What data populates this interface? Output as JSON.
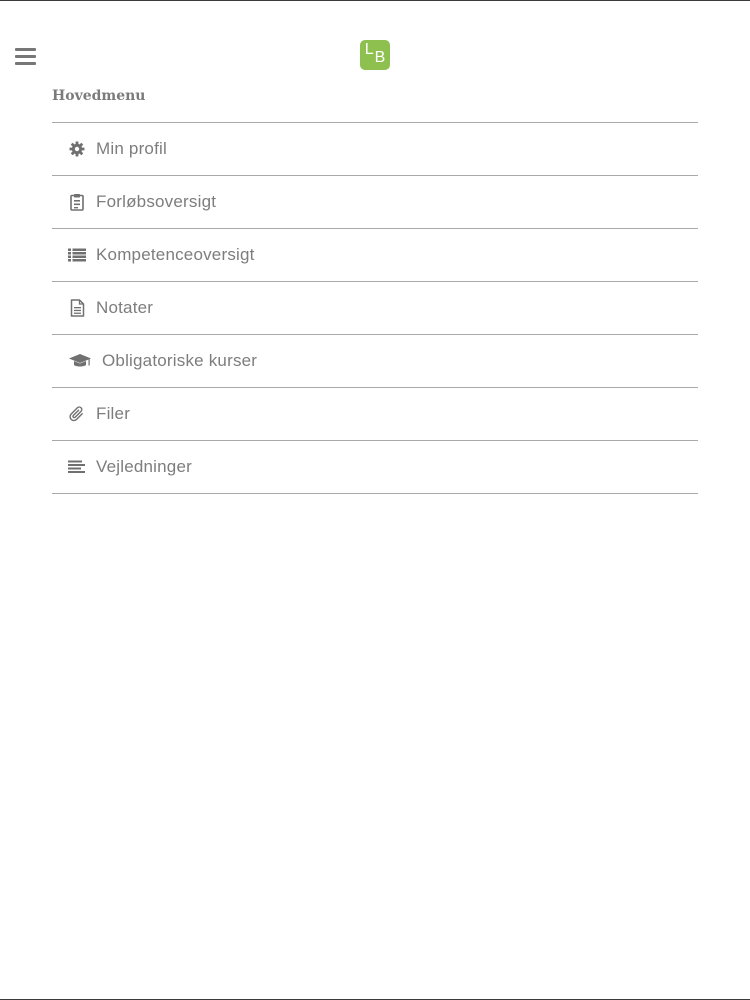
{
  "header": {
    "menu_icon": "hamburger-icon",
    "logo": {
      "letter_1": "L",
      "letter_2": "B",
      "color": "#8dc04e"
    }
  },
  "main_menu": {
    "heading": "Hovedmenu",
    "items": [
      {
        "label": "Min profil",
        "icon": "gear-icon"
      },
      {
        "label": "Forløbsoversigt",
        "icon": "clipboard-icon"
      },
      {
        "label": "Kompetenceoversigt",
        "icon": "list-icon"
      },
      {
        "label": "Notater",
        "icon": "document-icon"
      },
      {
        "label": "Obligatoriske kurser",
        "icon": "graduation-cap-icon"
      },
      {
        "label": "Filer",
        "icon": "paperclip-icon"
      },
      {
        "label": "Vejledninger",
        "icon": "align-left-icon"
      }
    ]
  }
}
